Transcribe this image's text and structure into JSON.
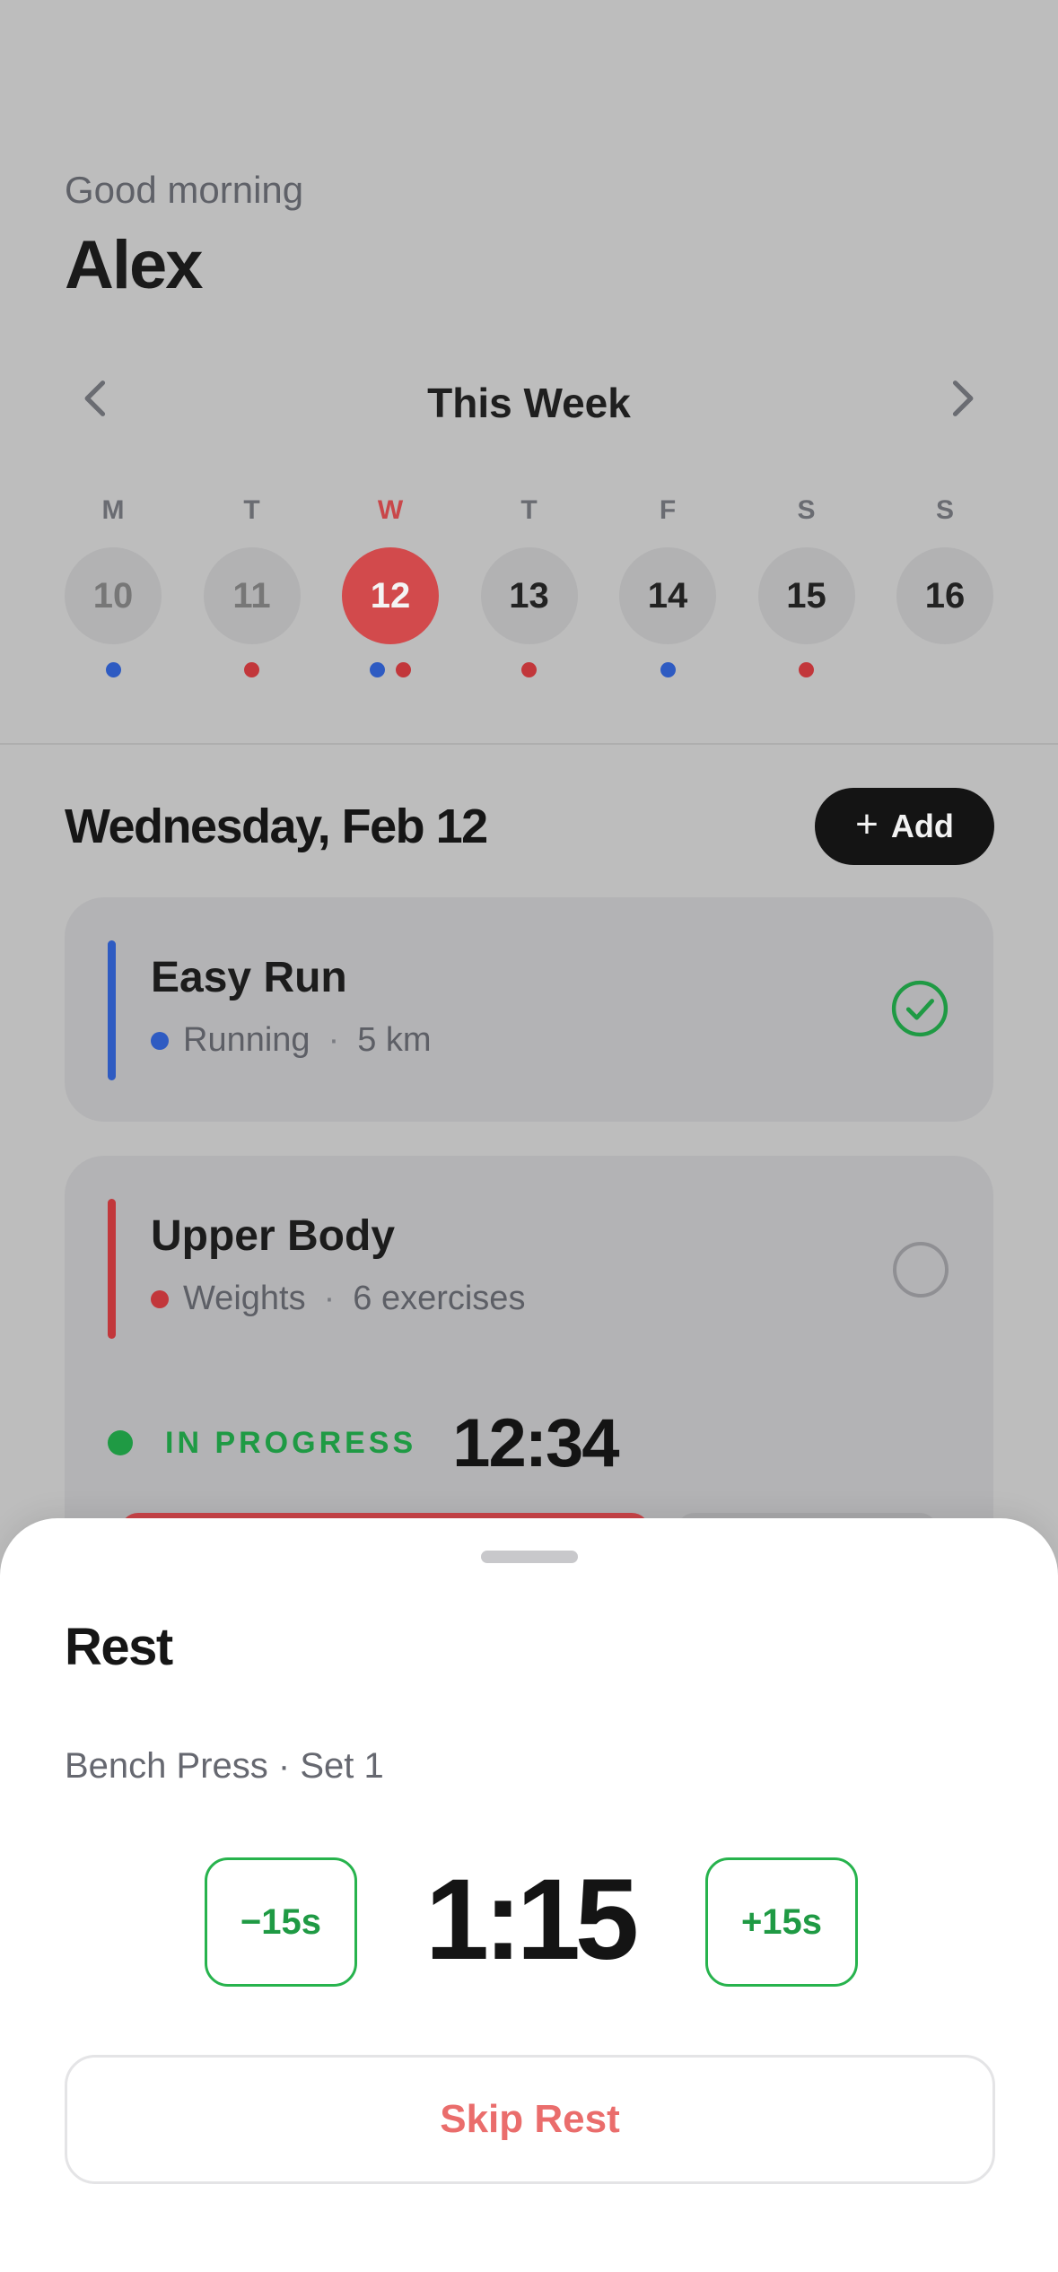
{
  "header": {
    "greeting": "Good morning",
    "name": "Alex"
  },
  "week": {
    "title": "This Week",
    "days": [
      {
        "letter": "M",
        "date": "10",
        "dots": [
          "blue"
        ]
      },
      {
        "letter": "T",
        "date": "11",
        "dots": [
          "red"
        ]
      },
      {
        "letter": "W",
        "date": "12",
        "dots": [
          "blue",
          "red"
        ]
      },
      {
        "letter": "T",
        "date": "13",
        "dots": [
          "red"
        ]
      },
      {
        "letter": "F",
        "date": "14",
        "dots": [
          "blue"
        ]
      },
      {
        "letter": "S",
        "date": "15",
        "dots": [
          "red"
        ]
      },
      {
        "letter": "S",
        "date": "16",
        "dots": []
      }
    ],
    "selected_date": "12"
  },
  "day_section": {
    "title": "Wednesday, Feb 12",
    "add_label": "Add"
  },
  "workouts": [
    {
      "title": "Easy Run",
      "type": "Running",
      "detail": "5 km",
      "color": "#2e5bc2",
      "completed": true
    },
    {
      "title": "Upper Body",
      "type": "Weights",
      "detail": "6 exercises",
      "color": "#c2373b",
      "completed": false,
      "status": "IN PROGRESS",
      "elapsed": "12:34"
    }
  ],
  "sep": "·",
  "rest_sheet": {
    "title": "Rest",
    "subtitle": "Bench Press · Set 1",
    "minus_label": "−15s",
    "timer": "1:15",
    "plus_label": "+15s",
    "skip_label": "Skip Rest"
  },
  "colors": {
    "accent_red": "#d24a4c",
    "success_green": "#1f9a44",
    "running_blue": "#2e5bc2"
  }
}
